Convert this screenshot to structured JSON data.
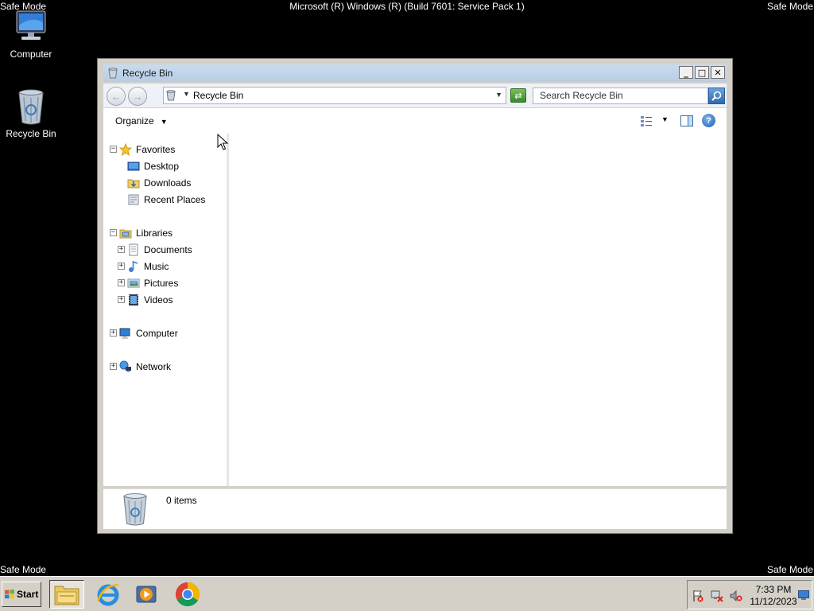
{
  "screen": {
    "safe_mode_label": "Safe Mode",
    "build_text": "Microsoft (R) Windows (R) (Build 7601: Service Pack 1)"
  },
  "desktop": {
    "icons": [
      {
        "label": "Computer",
        "icon": "computer-icon"
      },
      {
        "label": "Recycle Bin",
        "icon": "recycle-bin-icon"
      }
    ]
  },
  "window": {
    "title": "Recycle Bin",
    "controls": {
      "minimize": "_",
      "maximize": "□",
      "close": "✕"
    },
    "address": {
      "location": "Recycle Bin"
    },
    "search": {
      "placeholder": "Search Recycle Bin"
    },
    "toolbar": {
      "organize_label": "Organize"
    },
    "nav": {
      "favorites": {
        "label": "Favorites",
        "items": [
          "Desktop",
          "Downloads",
          "Recent Places"
        ]
      },
      "libraries": {
        "label": "Libraries",
        "items": [
          "Documents",
          "Music",
          "Pictures",
          "Videos"
        ]
      },
      "computer": {
        "label": "Computer"
      },
      "network": {
        "label": "Network"
      }
    },
    "details": {
      "item_count": "0 items"
    }
  },
  "taskbar": {
    "start_label": "Start",
    "apps": [
      "windows-explorer-icon",
      "internet-explorer-icon",
      "media-player-icon",
      "chrome-icon"
    ],
    "clock": {
      "time": "7:33 PM",
      "date": "11/12/2023"
    }
  },
  "colors": {
    "title_bar": "#c9dbee",
    "window_frame": "#d4d0c8",
    "taskbar": "#d4d0c8",
    "desktop": "#000000"
  }
}
